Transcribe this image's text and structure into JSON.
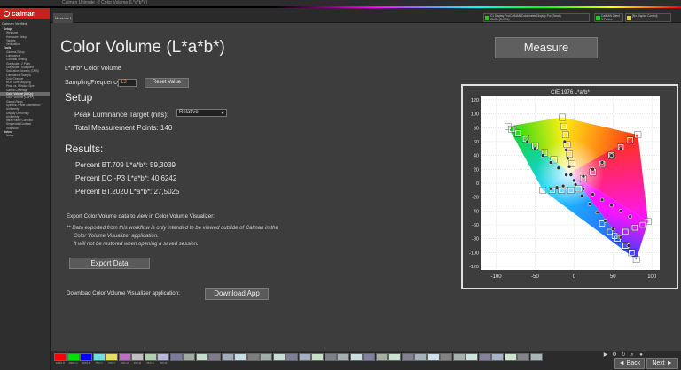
{
  "window": {
    "title": "Calman Ultimate - [ Color Volume (L*a*b*) ]"
  },
  "app": {
    "logo_text": "calman"
  },
  "sidebar": {
    "title": "Calman Verified",
    "items": [
      {
        "label": "Setup",
        "type": "group"
      },
      {
        "label": "Welcome",
        "type": "item"
      },
      {
        "label": "Hardware Setup",
        "type": "item"
      },
      {
        "label": "Targets",
        "type": "item"
      },
      {
        "label": "Verification",
        "type": "item"
      },
      {
        "label": "Tools",
        "type": "group"
      },
      {
        "label": "Gamma Setup",
        "type": "item"
      },
      {
        "label": "Luminance",
        "type": "item"
      },
      {
        "label": "Contrast Setting",
        "type": "item"
      },
      {
        "label": "Grayscale - 2 Point",
        "type": "item"
      },
      {
        "label": "Grayscale - Multipoint",
        "type": "item"
      },
      {
        "label": "Saturation Sweeps (CMS)",
        "type": "item"
      },
      {
        "label": "Luminance Sweeps",
        "type": "item"
      },
      {
        "label": "ColorChecker",
        "type": "item"
      },
      {
        "label": "HDR Tone Mapping",
        "type": "item"
      },
      {
        "label": "Peak vs. Window Size",
        "type": "item"
      },
      {
        "label": "Gamut Coverage",
        "type": "item"
      },
      {
        "label": "Color Volume (ICtCp)",
        "type": "item",
        "active": true
      },
      {
        "label": "Color Volume (L*a*b*)",
        "type": "item"
      },
      {
        "label": "Gamut Rings",
        "type": "item"
      },
      {
        "label": "Spectral Power Distribution",
        "type": "item"
      },
      {
        "label": "Uniformity",
        "type": "item"
      },
      {
        "label": "Display Uniformity",
        "type": "item"
      },
      {
        "label": "Uniformity",
        "type": "item"
      },
      {
        "label": "Intra-Frame Contrast",
        "type": "item"
      },
      {
        "label": "Sequential Contrast",
        "type": "item"
      },
      {
        "label": "Snapshot",
        "type": "item"
      },
      {
        "label": "Notes",
        "type": "group"
      },
      {
        "label": "Notes",
        "type": "item"
      }
    ]
  },
  "topbar": {
    "tab_label": "Measure 1",
    "devices": [
      {
        "label": "C1 Display Pro/CalMAN Colorimeter Display Pro (Small)",
        "sub": "OLED (D-CR4)",
        "color": "#2ec22e"
      },
      {
        "label": "CalMAN Client 3 Pattern Generator",
        "sub": "",
        "color": "#2ec22e"
      },
      {
        "label": "[No Display Control]",
        "sub": "",
        "color": "#e8d43a"
      }
    ]
  },
  "main": {
    "title": "Color Volume (L*a*b*)",
    "measure_label": "Measure",
    "subtitle": "L*a*b* Color Volume",
    "sampling_label": "SamplingFrequency",
    "sampling_value": "13",
    "reset_label": "Reset Value",
    "setup_heading": "Setup",
    "peak_label": "Peak Luminance Target (nits):",
    "peak_value": "Relative",
    "total_points": "Total Measurement Points: 140",
    "results_heading": "Results:",
    "result_bt709": "Percent BT.709 L*a*b*: 59,3039",
    "result_dcip3": "Percent DCI-P3 L*a*b*: 40,6242",
    "result_bt2020": "Percent BT.2020 L*a*b*: 27,5025",
    "export_intro": "Export Color Volume data to view in Color Volume Visualizer:",
    "export_note1": "** Data exported from this workflow is only intended to be viewed outside of Calman in the",
    "export_note2": "Color Volume Visualizer application.",
    "export_note3": "It will not be restored when opening a saved session.",
    "export_button": "Export Data",
    "download_label": "Download Color Volume Visualizer application:",
    "download_button": "Download App"
  },
  "chart_data": {
    "type": "scatter",
    "title": "CIE 1976 L*a*b*",
    "xlabel": "",
    "ylabel": "",
    "xlim": [
      -120,
      110
    ],
    "ylim": [
      -125,
      125
    ],
    "x_ticks": [
      -100,
      -50,
      0,
      50,
      100
    ],
    "y_ticks": [
      120,
      100,
      80,
      60,
      40,
      20,
      0,
      -20,
      -40,
      -60,
      -80,
      -100,
      -120
    ],
    "grid": true,
    "primaries": {
      "red": [
        82,
        70
      ],
      "yellow": [
        -15,
        95
      ],
      "green": [
        -85,
        82
      ],
      "cyan": [
        -40,
        -10
      ],
      "blue": [
        80,
        -110
      ],
      "magenta": [
        95,
        -55
      ]
    },
    "series": [
      {
        "name": "",
        "marker": "square",
        "points": [
          [
            -85,
            82
          ],
          [
            -80,
            78
          ],
          [
            -72,
            72
          ],
          [
            -62,
            64
          ],
          [
            -50,
            54
          ],
          [
            -38,
            44
          ],
          [
            -26,
            34
          ],
          [
            -15,
            95
          ],
          [
            -13,
            82
          ],
          [
            -11,
            70
          ],
          [
            -9,
            56
          ],
          [
            -6,
            42
          ],
          [
            -3,
            28
          ],
          [
            82,
            70
          ],
          [
            72,
            62
          ],
          [
            60,
            52
          ],
          [
            48,
            40
          ],
          [
            36,
            28
          ],
          [
            24,
            16
          ],
          [
            12,
            6
          ],
          [
            95,
            -55
          ],
          [
            88,
            -60
          ],
          [
            78,
            -64
          ],
          [
            66,
            -70
          ],
          [
            52,
            -76
          ],
          [
            80,
            -110
          ],
          [
            74,
            -100
          ],
          [
            66,
            -90
          ],
          [
            56,
            -80
          ],
          [
            46,
            -70
          ],
          [
            36,
            -58
          ],
          [
            -40,
            -10
          ],
          [
            -28,
            -10
          ],
          [
            -16,
            -10
          ],
          [
            -4,
            -10
          ],
          [
            6,
            -8
          ]
        ]
      },
      {
        "name": "",
        "marker": "circle",
        "points": [
          [
            -60,
            60
          ],
          [
            -50,
            50
          ],
          [
            -40,
            40
          ],
          [
            -30,
            30
          ],
          [
            -20,
            22
          ],
          [
            -10,
            12
          ],
          [
            0,
            4
          ],
          [
            -12,
            60
          ],
          [
            -10,
            48
          ],
          [
            -8,
            36
          ],
          [
            -6,
            24
          ],
          [
            -4,
            12
          ],
          [
            60,
            50
          ],
          [
            48,
            40
          ],
          [
            36,
            30
          ],
          [
            24,
            20
          ],
          [
            12,
            10
          ],
          [
            2,
            -2
          ],
          [
            70,
            -90
          ],
          [
            60,
            -78
          ],
          [
            50,
            -66
          ],
          [
            40,
            -54
          ],
          [
            30,
            -42
          ],
          [
            20,
            -30
          ],
          [
            10,
            -18
          ],
          [
            72,
            -48
          ],
          [
            60,
            -40
          ],
          [
            48,
            -32
          ],
          [
            36,
            -24
          ],
          [
            24,
            -16
          ],
          [
            12,
            -8
          ],
          [
            -30,
            -8
          ],
          [
            -22,
            -6
          ],
          [
            -14,
            -4
          ]
        ]
      }
    ]
  },
  "bottombar": {
    "swatches": [
      {
        "label": "100% R",
        "color": "#ff0000"
      },
      {
        "label": "100% G",
        "color": "#00e000"
      },
      {
        "label": "100% B",
        "color": "#0000ff"
      },
      {
        "label": "75% C",
        "color": "#6fe0e0"
      },
      {
        "label": "75% Y",
        "color": "#e6e060"
      },
      {
        "label": "50% M",
        "color": "#c070c0"
      },
      {
        "label": "25% R",
        "color": "#c0c0c0"
      },
      {
        "label": "25% G",
        "color": "#b0d0b0"
      },
      {
        "label": "25% B",
        "color": "#b8b8d8"
      }
    ],
    "back_label": "Back",
    "next_label": "Next"
  }
}
